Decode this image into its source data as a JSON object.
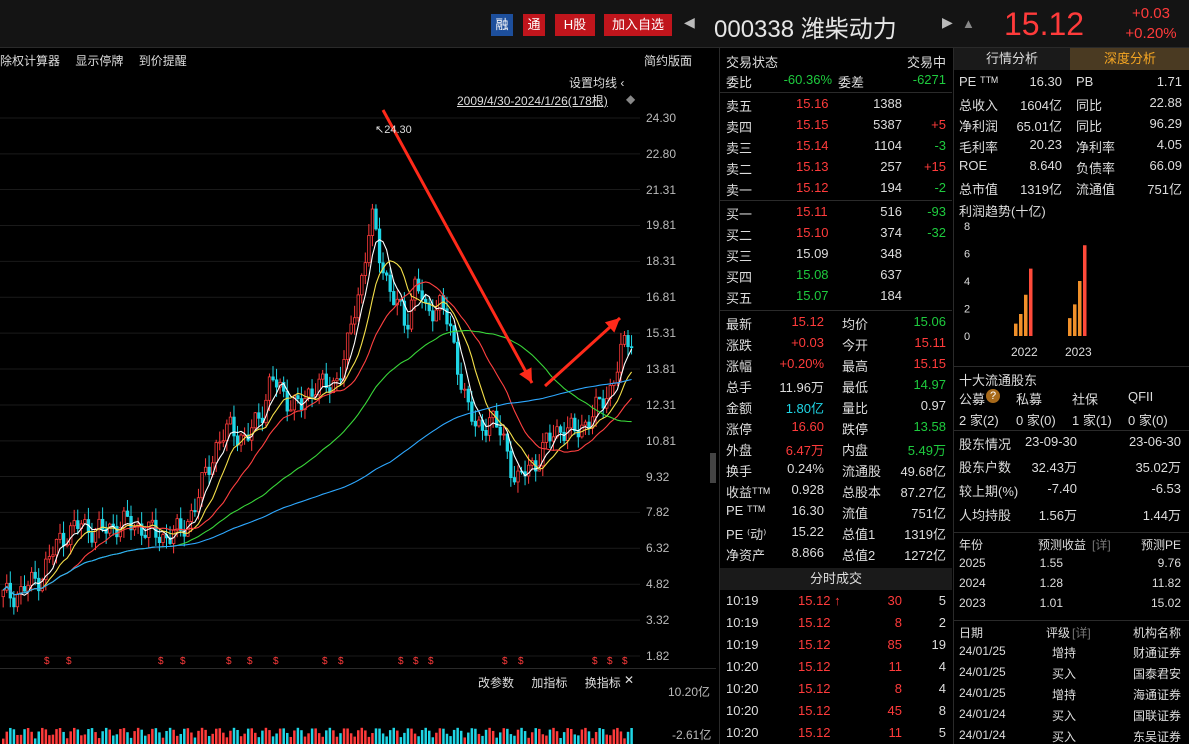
{
  "header": {
    "tag_rong": "融",
    "tag_tong": "通",
    "tag_h": "H股",
    "add_watch": "加入自选",
    "prev_arrow": "◀",
    "next_arrow": "▶",
    "stock_name": "000338 潍柴动力",
    "price": "15.12",
    "change": "+0.03",
    "change_pct": "+0.20%"
  },
  "chart": {
    "toolbar": [
      "除权计算器",
      "显示停牌",
      "到价提醒"
    ],
    "simple_view": "简约版面",
    "ma_setting": "设置均线",
    "date_range": "2009/4/30-2024/1/26(178根)",
    "peak_label": "↖24.30",
    "y_ticks": [
      "24.30",
      "22.80",
      "21.31",
      "19.81",
      "18.31",
      "16.81",
      "15.31",
      "13.81",
      "12.31",
      "10.81",
      "9.32",
      "7.82",
      "6.32",
      "4.82",
      "3.32",
      "1.82"
    ],
    "indicator_toolbar": [
      "改参数",
      "加指标",
      "换指标"
    ],
    "indicator_close": "✕",
    "vol_top": "10.20亿",
    "vol_bottom": "-2.61亿",
    "dividend_mark": "$",
    "colors": {
      "up": "#ff3b3b",
      "down": "#1fd6e6",
      "ma5": "#ffffff",
      "ma10": "#f5e04a",
      "ma20": "#ff4040",
      "ma60": "#39d639",
      "ma120": "#2ea8ff",
      "annotation": "#ff2a1a"
    }
  },
  "chart_data": {
    "type": "candlestick",
    "period": "monthly",
    "range": "2009/4/30-2024/1/26",
    "bars": 178,
    "ylim": [
      1.82,
      24.3
    ],
    "max_high": 24.3,
    "last_close": 15.12,
    "last_chg": "+0.03",
    "last_pct": "+0.20%"
  },
  "orderbook": {
    "status_label": "交易状态",
    "status_value": "交易中",
    "weibi_label": "委比",
    "weibi_value": "-60.36%",
    "weicha_label": "委差",
    "weicha_value": "-6271",
    "asks": [
      {
        "label": "卖五",
        "price": "15.16",
        "vol": "1388",
        "chg": ""
      },
      {
        "label": "卖四",
        "price": "15.15",
        "vol": "5387",
        "chg": "+5"
      },
      {
        "label": "卖三",
        "price": "15.14",
        "vol": "1104",
        "chg": "-3"
      },
      {
        "label": "卖二",
        "price": "15.13",
        "vol": "257",
        "chg": "+15"
      },
      {
        "label": "卖一",
        "price": "15.12",
        "vol": "194",
        "chg": "-2"
      }
    ],
    "bids": [
      {
        "label": "买一",
        "price": "15.11",
        "vol": "516",
        "chg": "-93"
      },
      {
        "label": "买二",
        "price": "15.10",
        "vol": "374",
        "chg": "-32"
      },
      {
        "label": "买三",
        "price": "15.09",
        "vol": "348",
        "chg": ""
      },
      {
        "label": "买四",
        "price": "15.08",
        "vol": "637",
        "chg": ""
      },
      {
        "label": "买五",
        "price": "15.07",
        "vol": "184",
        "chg": ""
      }
    ],
    "stats": [
      {
        "k1": "最新",
        "v1": "15.12",
        "k2": "均价",
        "v2": "15.06"
      },
      {
        "k1": "涨跌",
        "v1": "+0.03",
        "k2": "今开",
        "v2": "15.11"
      },
      {
        "k1": "涨幅",
        "v1": "+0.20%",
        "k2": "最高",
        "v2": "15.15"
      },
      {
        "k1": "总手",
        "v1": "11.96万",
        "k2": "最低",
        "v2": "14.97"
      },
      {
        "k1": "金额",
        "v1": "1.80亿",
        "k2": "量比",
        "v2": "0.97"
      },
      {
        "k1": "涨停",
        "v1": "16.60",
        "k2": "跌停",
        "v2": "13.58"
      },
      {
        "k1": "外盘",
        "v1": "6.47万",
        "k2": "内盘",
        "v2": "5.49万"
      },
      {
        "k1": "换手",
        "v1": "0.24%",
        "k2": "流通股",
        "v2": "49.68亿"
      },
      {
        "k1": "收益ᵀᵀᴹ",
        "v1": "0.928",
        "k2": "总股本",
        "v2": "87.27亿"
      },
      {
        "k1": "PE ᵀᵀᴹ",
        "v1": "16.30",
        "k2": "流值",
        "v2": "751亿"
      },
      {
        "k1": "PE ⁽动⁾",
        "v1": "15.22",
        "k2": "总值1",
        "v2": "1319亿"
      },
      {
        "k1": "净资产",
        "v1": "8.866",
        "k2": "总值2",
        "v2": "1272亿"
      }
    ],
    "ticks_header": "分时成交",
    "ticks": [
      {
        "time": "10:19",
        "price": "15.12 ↑",
        "vol": "30",
        "cnt": "5"
      },
      {
        "time": "10:19",
        "price": "15.12",
        "vol": "8",
        "cnt": "2"
      },
      {
        "time": "10:19",
        "price": "15.12",
        "vol": "85",
        "cnt": "19"
      },
      {
        "time": "10:20",
        "price": "15.12",
        "vol": "11",
        "cnt": "4"
      },
      {
        "time": "10:20",
        "price": "15.12",
        "vol": "8",
        "cnt": "4"
      },
      {
        "time": "10:20",
        "price": "15.12",
        "vol": "45",
        "cnt": "8"
      },
      {
        "time": "10:20",
        "price": "15.12",
        "vol": "11",
        "cnt": "5"
      }
    ]
  },
  "panel": {
    "tab_quote": "行情分析",
    "tab_deep": "深度分析",
    "fin": [
      {
        "k1": "PE ᵀᵀᴹ",
        "v1": "16.30",
        "k2": "PB",
        "v2": "1.71"
      },
      {
        "k1": "总收入",
        "v1": "1604亿",
        "k2": "同比",
        "v2": "22.88"
      },
      {
        "k1": "净利润",
        "v1": "65.01亿",
        "k2": "同比",
        "v2": "96.29"
      },
      {
        "k1": "毛利率",
        "v1": "20.23",
        "k2": "净利率",
        "v2": "4.05"
      },
      {
        "k1": "ROE",
        "v1": "8.640",
        "k2": "负债率",
        "v2": "66.09"
      },
      {
        "k1": "总市值",
        "v1": "1319亿",
        "k2": "流通值",
        "v2": "751亿"
      }
    ],
    "profit_title": "利润趋势(十亿)",
    "profit_y": [
      "8",
      "6",
      "4",
      "2",
      "0"
    ],
    "profit_years": [
      "2022",
      "2023"
    ],
    "holders_title": "十大流通股东",
    "holder_types": [
      "公募",
      "私募",
      "社保",
      "QFII"
    ],
    "holder_counts": [
      "2 家(2)",
      "0 家(0)",
      "1 家(1)",
      "0 家(0)"
    ],
    "help_icon": "?",
    "shareholder_header": [
      "股东情况",
      "23-09-30",
      "23-06-30"
    ],
    "shareholder_rows": [
      [
        "股东户数",
        "32.43万",
        "35.02万"
      ],
      [
        "较上期(%)",
        "-7.40",
        "-6.53"
      ],
      [
        "人均持股",
        "1.56万",
        "1.44万"
      ]
    ],
    "forecast_header": [
      "年份",
      "预测收益",
      "[详]",
      "预测PE"
    ],
    "forecast_rows": [
      [
        "2025",
        "1.55",
        "9.76"
      ],
      [
        "2024",
        "1.28",
        "11.82"
      ],
      [
        "2023",
        "1.01",
        "15.02"
      ]
    ],
    "rating_header": [
      "日期",
      "评级",
      "[详]",
      "机构名称"
    ],
    "rating_rows": [
      [
        "24/01/25",
        "增持",
        "财通证券"
      ],
      [
        "24/01/25",
        "买入",
        "国泰君安"
      ],
      [
        "24/01/25",
        "增持",
        "海通证券"
      ],
      [
        "24/01/24",
        "买入",
        "国联证券"
      ],
      [
        "24/01/24",
        "买入",
        "东吴证券"
      ]
    ]
  }
}
